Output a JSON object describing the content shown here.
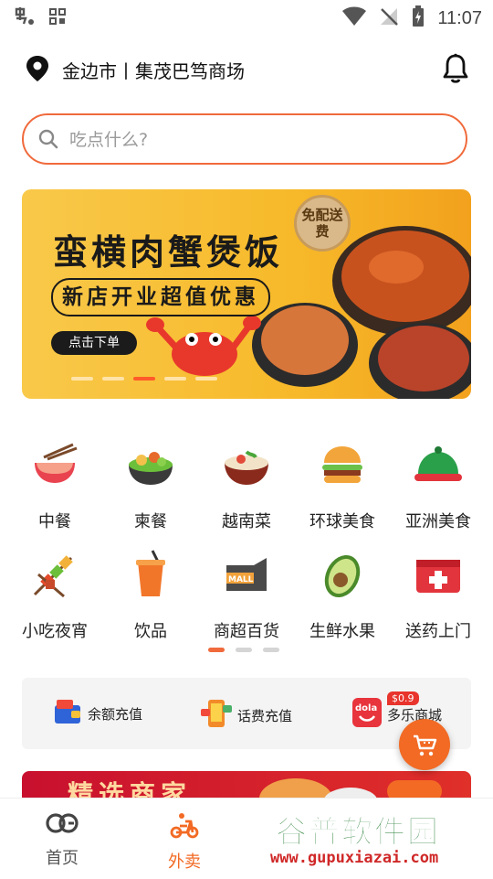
{
  "status_bar": {
    "time": "11:07"
  },
  "header": {
    "location": "金边市丨集茂巴笃商场"
  },
  "search": {
    "placeholder": "吃点什么?"
  },
  "banner": {
    "title": "蛮横肉蟹煲饭",
    "subtitle": "新店开业超值优惠",
    "button_label": "点击下单",
    "badge": "免配送费",
    "slide_count": 5,
    "active_slide": 3
  },
  "categories": [
    {
      "label": "中餐",
      "icon": "chinese-food-icon"
    },
    {
      "label": "柬餐",
      "icon": "cambodian-food-icon"
    },
    {
      "label": "越南菜",
      "icon": "vietnamese-food-icon"
    },
    {
      "label": "环球美食",
      "icon": "burger-icon"
    },
    {
      "label": "亚洲美食",
      "icon": "asian-dish-icon"
    },
    {
      "label": "小吃夜宵",
      "icon": "skewer-icon"
    },
    {
      "label": "饮品",
      "icon": "drink-icon"
    },
    {
      "label": "商超百货",
      "icon": "mall-icon"
    },
    {
      "label": "生鲜水果",
      "icon": "avocado-icon"
    },
    {
      "label": "送药上门",
      "icon": "medicine-icon"
    }
  ],
  "category_pages": {
    "count": 3,
    "active": 1
  },
  "services": [
    {
      "label": "余额充值",
      "icon": "wallet-icon"
    },
    {
      "label": "话费充值",
      "icon": "phone-topup-icon"
    },
    {
      "label": "多乐商城",
      "icon": "dola-mall-icon",
      "tag": "$0.9"
    }
  ],
  "promo": {
    "text": "精选商家"
  },
  "tabbar": [
    {
      "label": "首页",
      "icon": "home-logo-icon",
      "active": false
    },
    {
      "label": "外卖",
      "icon": "delivery-scooter-icon",
      "active": true
    }
  ],
  "watermark": {
    "title": "谷普软件园",
    "url": "www.gupuxiazai.com"
  },
  "colors": {
    "accent": "#f06a3c",
    "banner": "#f7b92a",
    "text": "#222222"
  }
}
